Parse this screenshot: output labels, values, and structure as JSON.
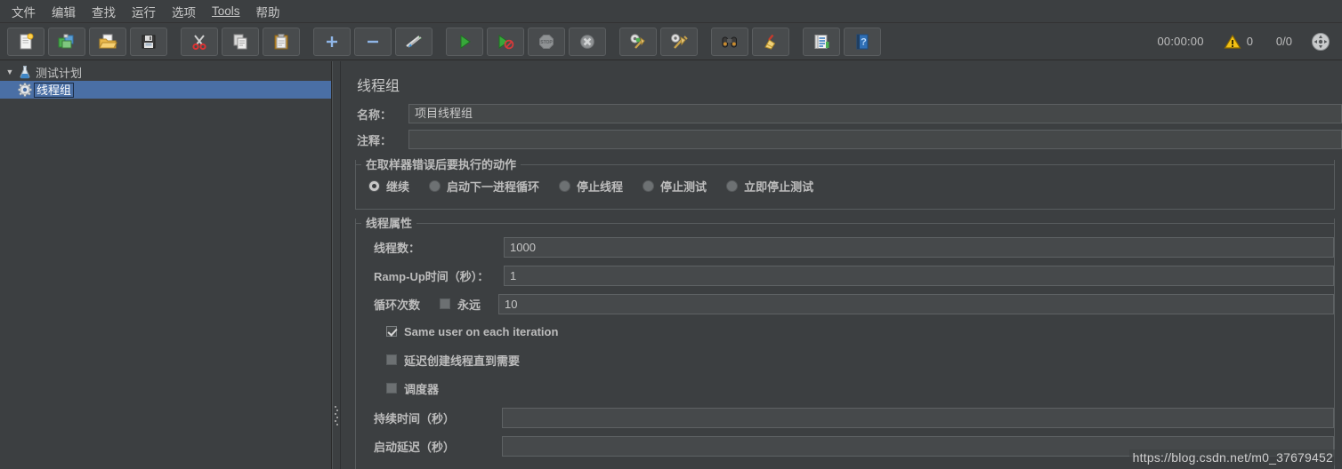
{
  "window": {
    "bg_color": "#3c3f41",
    "accent_selection": "#4a6fa5"
  },
  "menubar": {
    "items": [
      {
        "label": "文件",
        "name": "menu-file"
      },
      {
        "label": "编辑",
        "name": "menu-edit"
      },
      {
        "label": "查找",
        "name": "menu-search"
      },
      {
        "label": "运行",
        "name": "menu-run"
      },
      {
        "label": "选项",
        "name": "menu-options"
      },
      {
        "label": "Tools",
        "name": "menu-tools",
        "mnemonic": "T"
      },
      {
        "label": "帮助",
        "name": "menu-help"
      }
    ]
  },
  "toolbar": {
    "buttons": [
      {
        "icon": "new-file-icon",
        "name": "new-button"
      },
      {
        "icon": "templates-icon",
        "name": "templates-button"
      },
      {
        "icon": "open-folder-icon",
        "name": "open-button"
      },
      {
        "icon": "save-floppy-icon",
        "name": "save-button"
      },
      {
        "icon": "cut-scissors-icon",
        "name": "cut-button"
      },
      {
        "icon": "copy-pages-icon",
        "name": "copy-button"
      },
      {
        "icon": "paste-clipboard-icon",
        "name": "paste-button"
      },
      {
        "icon": "plus-icon",
        "name": "expand-all-button"
      },
      {
        "icon": "minus-icon",
        "name": "collapse-all-button"
      },
      {
        "icon": "toggle-arrows-icon",
        "name": "toggle-button"
      },
      {
        "icon": "play-icon",
        "name": "start-button"
      },
      {
        "icon": "play-no-timers-icon",
        "name": "start-no-pauses-button"
      },
      {
        "icon": "stop-icon",
        "name": "stop-button"
      },
      {
        "icon": "shutdown-icon",
        "name": "shutdown-button"
      },
      {
        "icon": "clear-gear-broom-icon",
        "name": "clear-button"
      },
      {
        "icon": "clear-all-broom-icon",
        "name": "clear-all-button"
      },
      {
        "icon": "binoculars-search-icon",
        "name": "search-button"
      },
      {
        "icon": "reset-broom-icon",
        "name": "reset-search-button"
      },
      {
        "icon": "function-helper-icon",
        "name": "function-helper-button"
      },
      {
        "icon": "help-book-icon",
        "name": "help-button"
      }
    ],
    "status": {
      "timer": "00:00:00",
      "warning_icon": "warning-triangle-icon",
      "warning_count": "0",
      "threads": "0/0",
      "indicator_icon": "connection-indicator-icon"
    }
  },
  "tree": {
    "root": {
      "label": "测试计划",
      "icon": "test-plan-flask-icon",
      "expanded": true
    },
    "children": [
      {
        "label": "线程组",
        "icon": "thread-group-gear-icon",
        "selected": true
      }
    ]
  },
  "panel": {
    "title": "线程组",
    "name_label": "名称：",
    "name_value": "项目线程组",
    "comment_label": "注释：",
    "comment_value": "",
    "error_action": {
      "group_title": "在取样器错误后要执行的动作",
      "options": [
        {
          "label": "继续",
          "checked": true,
          "name": "radio-continue"
        },
        {
          "label": "启动下一进程循环",
          "checked": false,
          "name": "radio-start-next-loop"
        },
        {
          "label": "停止线程",
          "checked": false,
          "name": "radio-stop-thread"
        },
        {
          "label": "停止测试",
          "checked": false,
          "name": "radio-stop-test"
        },
        {
          "label": "立即停止测试",
          "checked": false,
          "name": "radio-stop-test-now"
        }
      ]
    },
    "thread_properties": {
      "group_title": "线程属性",
      "num_threads_label": "线程数：",
      "num_threads_value": "1000",
      "ramp_up_label": "Ramp-Up时间（秒）：",
      "ramp_up_value": "1",
      "loop_count_label": "循环次数",
      "forever_label": "永远",
      "forever_checked": false,
      "loop_count_value": "10",
      "checkboxes": [
        {
          "label": "Same user on each iteration",
          "checked": true,
          "name": "checkbox-same-user"
        },
        {
          "label": "延迟创建线程直到需要",
          "checked": false,
          "name": "checkbox-delayed-start"
        },
        {
          "label": "调度器",
          "checked": false,
          "name": "checkbox-scheduler"
        }
      ],
      "duration_label": "持续时间（秒）",
      "duration_value": "",
      "startup_delay_label": "启动延迟（秒）",
      "startup_delay_value": ""
    }
  },
  "watermark": "https://blog.csdn.net/m0_37679452"
}
